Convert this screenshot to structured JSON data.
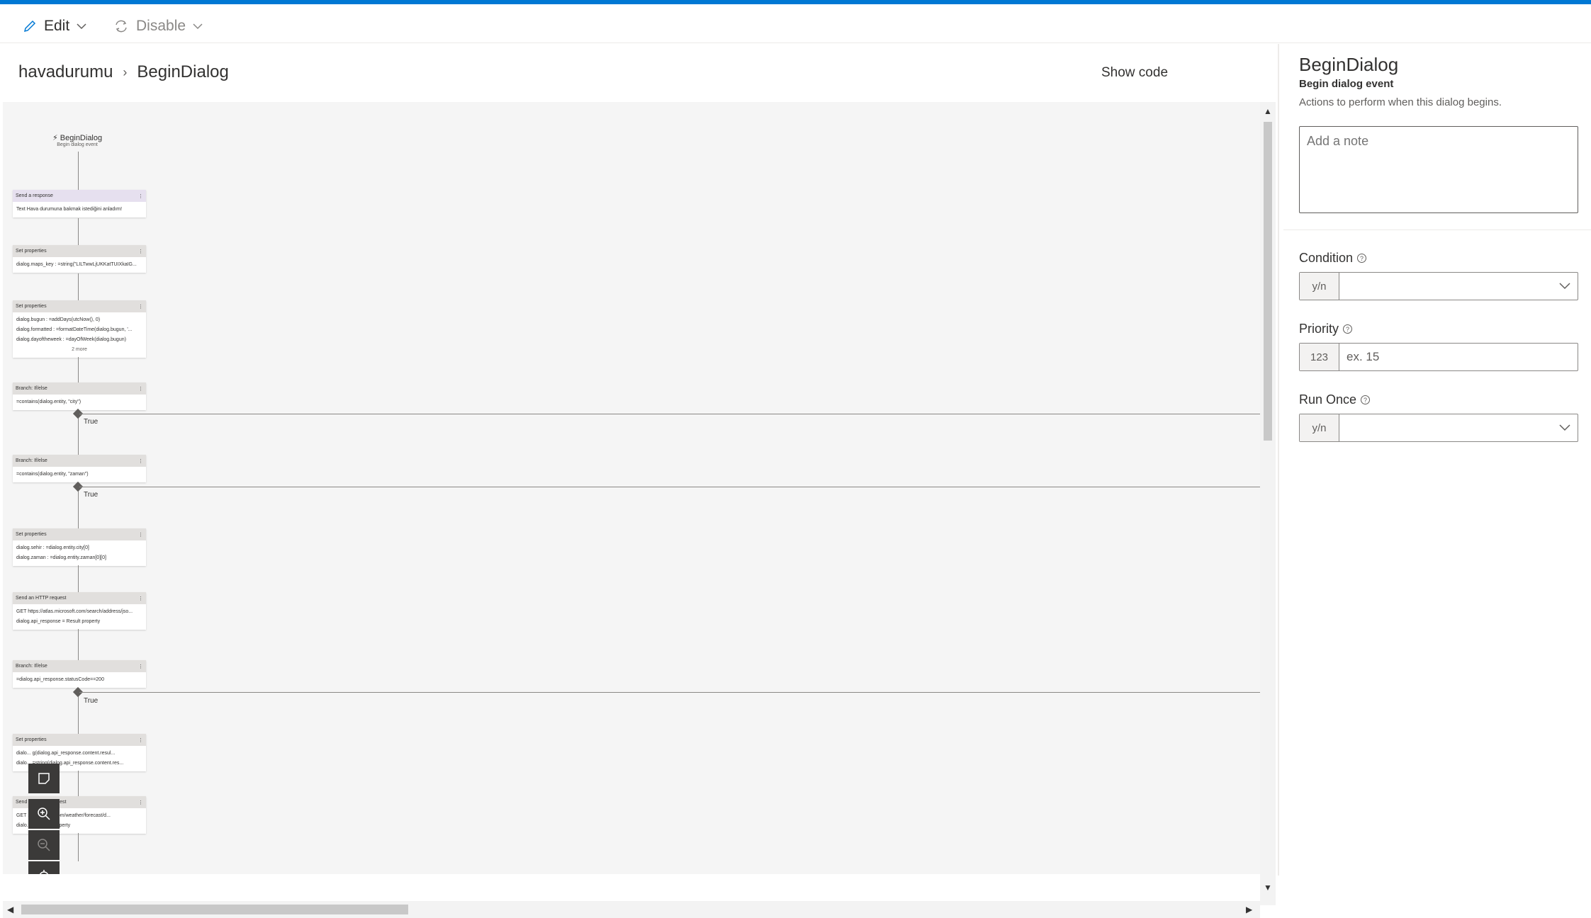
{
  "toolbar": {
    "edit_label": "Edit",
    "disable_label": "Disable"
  },
  "breadcrumb": {
    "parent": "havadurumu",
    "current": "BeginDialog"
  },
  "show_code_label": "Show code",
  "flow": {
    "trigger": {
      "title": "BeginDialog",
      "subtitle": "Begin dialog event"
    },
    "nodes": [
      {
        "header": "Send a response",
        "lines": [
          "Text  Hava durumuna bakmak istediğini anladım!"
        ]
      },
      {
        "header": "Set properties",
        "lines": [
          "dialog.maps_key : =string(\"LILTwwLjUKKatTUIXkaIG..."
        ]
      },
      {
        "header": "Set properties",
        "lines": [
          "dialog.bugun : =addDays(utcNow(), 0)",
          "dialog.formatted : =formatDateTime(dialog.bugun, '...",
          "dialog.dayoftheweek : =dayOfWeek(dialog.bugun)"
        ],
        "more": "2 more"
      },
      {
        "header": "Branch: If/else",
        "lines": [
          "=contains(dialog.entity, \"city\")"
        ]
      },
      {
        "header": "Branch: If/else",
        "lines": [
          "=contains(dialog.entity, \"zaman\")"
        ]
      },
      {
        "header": "Set properties",
        "lines": [
          "dialog.sehir : =dialog.entity.city[0]",
          "dialog.zaman : =dialog.entity.zaman[0][0]"
        ]
      },
      {
        "header": "Send an HTTP request",
        "lines": [
          "GET https://atlas.microsoft.com/search/address/jso...",
          "dialog.api_response = Result property"
        ]
      },
      {
        "header": "Branch: If/else",
        "lines": [
          "=dialog.api_response.statusCode==200"
        ]
      },
      {
        "header": "Set properties",
        "lines": [
          "dialo...  g(dialog.api_response.content.resul...",
          "dialo...  =string(dialog.api_response.content.res..."
        ]
      },
      {
        "header": "Send an HTTP request",
        "lines": [
          "GET ...  microsoft.com/weather/forecast/d...",
          "dialo...  = Result property"
        ]
      }
    ],
    "true_label": "True"
  },
  "properties": {
    "title": "BeginDialog",
    "subtitle": "Begin dialog event",
    "description": "Actions to perform when this dialog begins.",
    "note_placeholder": "Add a note",
    "condition": {
      "label": "Condition",
      "prefix": "y/n",
      "value": ""
    },
    "priority": {
      "label": "Priority",
      "prefix": "123",
      "placeholder": "ex. 15"
    },
    "run_once": {
      "label": "Run Once",
      "prefix": "y/n",
      "value": ""
    }
  },
  "colors": {
    "accent": "#0078d4"
  }
}
